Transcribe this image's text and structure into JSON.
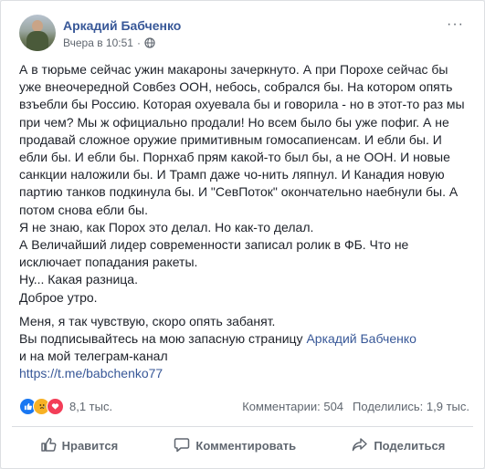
{
  "post": {
    "author": "Аркадий Бабченко",
    "timestamp": "Вчера в 10:51",
    "privacy_icon": "globe-icon",
    "menu_label": "···",
    "paragraphs": [
      "А в тюрьме сейчас ужин макароны зачеркнуто. А при Порохе сейчас бы уже внеочередной Совбез ООН, небось, собрался бы. На котором опять взъебли бы Россию. Которая охуевала бы и говорила - но в этот-то раз мы при чем? Мы ж официально продали! Но всем было бы уже пофиг. А не продавай сложное оружие примитивным гомосапиенсам. И ебли бы. И ебли бы. И ебли бы. Порнхаб прям какой-то был бы, а не ООН. И новые санкции наложили бы. И Трамп даже чо-нить ляпнул. И Канадия новую партию танков подкинула бы. И \"СевПоток\" окончательно наебнули бы. А потом снова ебли бы.",
      "Я не знаю, как Порох это делал. Но как-то делал.",
      "А Величайший лидер современности записал ролик в ФБ. Что не исключает попадания ракеты.",
      "Ну... Какая разница.",
      "Доброе утро."
    ],
    "closing": {
      "line1": "Меня, я так чувствую, скоро опять забанят.",
      "line2_prefix": "Вы подписывайтесь на мою запасную страницу ",
      "line2_link": "Аркадий Бабченко",
      "line3": "и на мой телеграм-канал",
      "telegram_link": "https://t.me/babchenko77"
    }
  },
  "stats": {
    "reactions": [
      "like",
      "sad",
      "love"
    ],
    "reaction_count": "8,1 тыс.",
    "comments": "Комментарии: 504",
    "shares": "Поделились: 1,9 тыс."
  },
  "actions": {
    "like": "Нравится",
    "comment": "Комментировать",
    "share": "Поделиться"
  },
  "colors": {
    "link": "#385898",
    "meta": "#606770",
    "like": "#1877f2",
    "love": "#f33e58",
    "sad": "#f7b125"
  }
}
